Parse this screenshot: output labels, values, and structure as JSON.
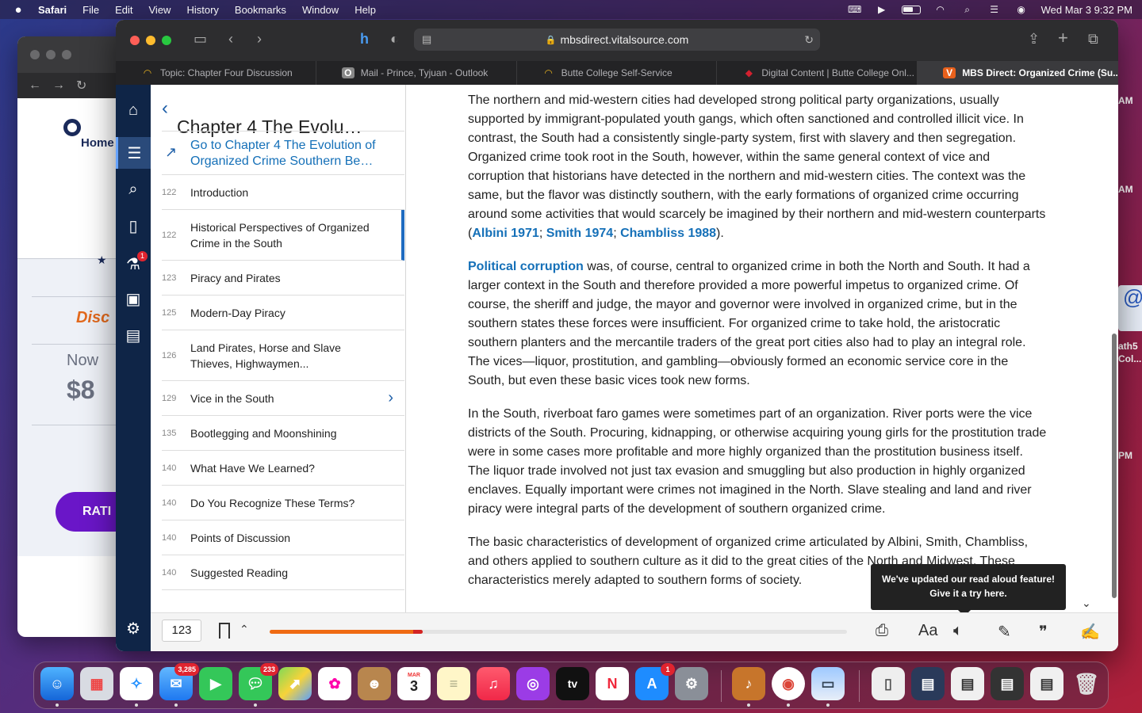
{
  "menubar": {
    "app_name": "Safari",
    "menus": [
      "File",
      "Edit",
      "View",
      "History",
      "Bookmarks",
      "Window",
      "Help"
    ],
    "clock": "Wed Mar 3  9:32 PM"
  },
  "back_window": {
    "home_label": "Home",
    "discount_label": "Disc",
    "now_label": "Now",
    "price": "$8",
    "rate_label": "RATI"
  },
  "right_fragments": {
    "am1": "AM",
    "am2": "AM",
    "pm": "PM",
    "card_text1": "ath5",
    "card_text2": "Col..."
  },
  "browser": {
    "url": "mbsdirect.vitalsource.com",
    "tabs": [
      {
        "label": "Topic: Chapter Four Discussion",
        "active": false
      },
      {
        "label": "Mail - Prince, Tyjuan - Outlook",
        "active": false,
        "favicon_letter": "O"
      },
      {
        "label": "Butte College Self-Service",
        "active": false
      },
      {
        "label": "Digital Content | Butte College Onl...",
        "active": false
      },
      {
        "label": "MBS Direct: Organized Crime (Su...",
        "active": true,
        "favicon_letter": "V"
      }
    ]
  },
  "toc": {
    "chapter_title": "Chapter 4 The Evolu…",
    "goto_text": "Go to Chapter 4 The Evolution of Organized Crime Southern Be…",
    "items": [
      {
        "page": "122",
        "label": "Introduction"
      },
      {
        "page": "122",
        "label": "Historical Perspectives of Organized Crime in the South",
        "current": true
      },
      {
        "page": "123",
        "label": "Piracy and Pirates"
      },
      {
        "page": "125",
        "label": "Modern-Day Piracy"
      },
      {
        "page": "126",
        "label": "Land Pirates, Horse and Slave Thieves, Highwaymen..."
      },
      {
        "page": "129",
        "label": "Vice in the South",
        "has_children": true
      },
      {
        "page": "135",
        "label": "Bootlegging and Moonshining"
      },
      {
        "page": "140",
        "label": "What Have We Learned?"
      },
      {
        "page": "140",
        "label": "Do You Recognize These Terms?"
      },
      {
        "page": "140",
        "label": "Points of Discussion"
      },
      {
        "page": "140",
        "label": "Suggested Reading"
      }
    ]
  },
  "rail": {
    "flask_badge": "1"
  },
  "reader": {
    "p1_text": "The northern and mid-western cities had developed strong political party organizations, usually supported by immigrant-populated youth gangs, which often sanctioned and controlled illicit vice. In contrast, the South had a consistently single-party system, first with slavery and then segregation. Organized crime took root in the South, however, within the same general context of vice and corruption that historians have detected in the northern and mid-western cities. The context was the same, but the flavor was distinctly southern, with the early formations of organized crime occurring around some activities that would scarcely be imagined by their northern and mid-western counterparts (",
    "p1_ref1": "Albini 1971",
    "p1_sep1": "; ",
    "p1_ref2": "Smith 1974",
    "p1_sep2": "; ",
    "p1_ref3": "Chambliss 1988",
    "p1_end": ").",
    "p2_term": "Political corruption",
    "p2_text": " was, of course, central to organized crime in both the North and South. It had a larger context in the South and therefore provided a more powerful impetus to organized crime. Of course, the sheriff and judge, the mayor and governor were involved in organized crime, but in the southern states these forces were insufficient. For organized crime to take hold, the aristocratic southern planters and the mercantile traders of the great port cities also had to play an integral role. The vices—liquor, prostitution, and gambling—obviously formed an economic service core in the South, but even these basic vices took new forms.",
    "p3_text": "In the South, riverboat faro games were sometimes part of an organization. River ports were the vice districts of the South. Procuring, kidnapping, or otherwise acquiring young girls for the prostitution trade were in some cases more profitable and more highly organized than the prostitution business itself. The liquor trade involved not just tax evasion and smuggling but also production in highly organized enclaves. Equally important were crimes not imagined in the North. Slave stealing and land and river piracy were integral parts of the development of southern organized crime.",
    "p4_text": "The basic characteristics of development of organized crime articulated by Albini, Smith, Chambliss, and others applied to southern culture as it did to the great cities of the North and Midwest. These characteristics merely adapted to southern forms of society."
  },
  "tooltip": {
    "line1": "We've updated our read aloud feature!",
    "line2": "Give it a try here."
  },
  "bottombar": {
    "page_number": "123",
    "progress_fraction": 0.265,
    "font_label": "Aa"
  },
  "dock": {
    "mail_badge": "3,285",
    "messages_badge": "233",
    "calendar_month": "MAR",
    "calendar_day": "3",
    "appletv_label": "tv",
    "appstore_badge": "1"
  }
}
